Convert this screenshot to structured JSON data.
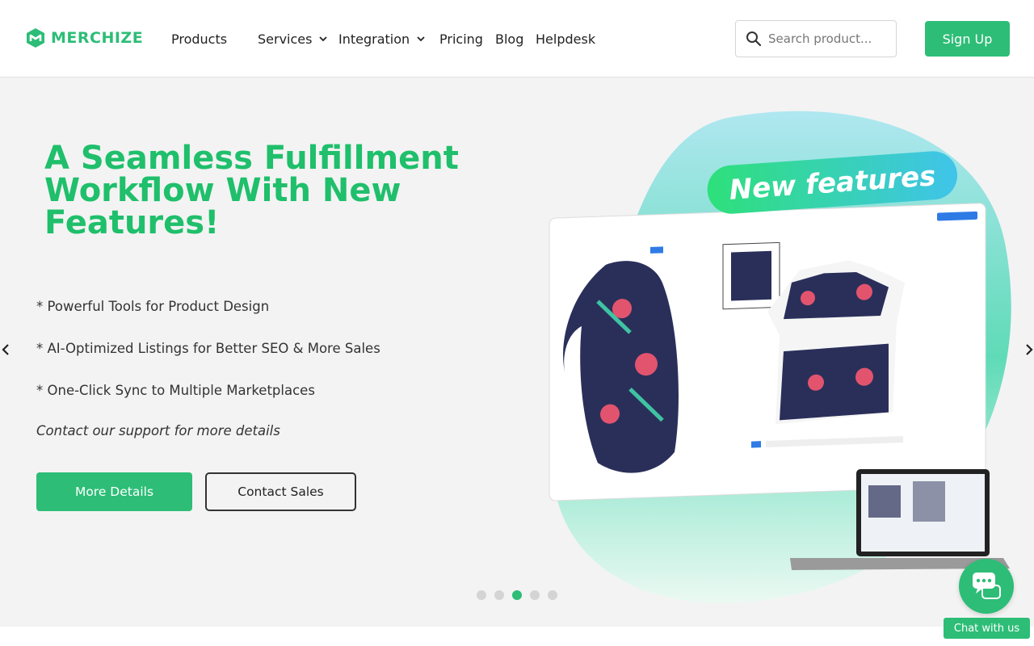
{
  "brand": {
    "name": "MERCHIZE",
    "color": "#2dbd77"
  },
  "nav": {
    "items": [
      {
        "label": "Products",
        "has_dropdown": false
      },
      {
        "label": "Services",
        "has_dropdown": true
      },
      {
        "label": "Integration",
        "has_dropdown": true
      },
      {
        "label": "Pricing",
        "has_dropdown": false
      },
      {
        "label": "Blog",
        "has_dropdown": false
      },
      {
        "label": "Helpdesk",
        "has_dropdown": false
      }
    ]
  },
  "search": {
    "placeholder": "Search product...",
    "icon": "search-icon"
  },
  "signup_label": "Sign Up",
  "hero": {
    "title": "A Seamless Fulfillment Workflow With New Features!",
    "bullets": [
      "* Powerful Tools for Product Design",
      "* AI-Optimized Listings for Better SEO & More Sales",
      "* One-Click Sync to Multiple Marketplaces"
    ],
    "note": "Contact our support for more details",
    "btn_more": "More Details",
    "btn_contact": "Contact Sales",
    "illustration_badge": "New features"
  },
  "carousel": {
    "slide_count": 5,
    "active_index": 2
  },
  "chat": {
    "label": "Chat with us"
  },
  "colors": {
    "accent": "#2dbd77",
    "title_green": "#1fbf6b",
    "hero_bg": "#f3f3f3"
  }
}
